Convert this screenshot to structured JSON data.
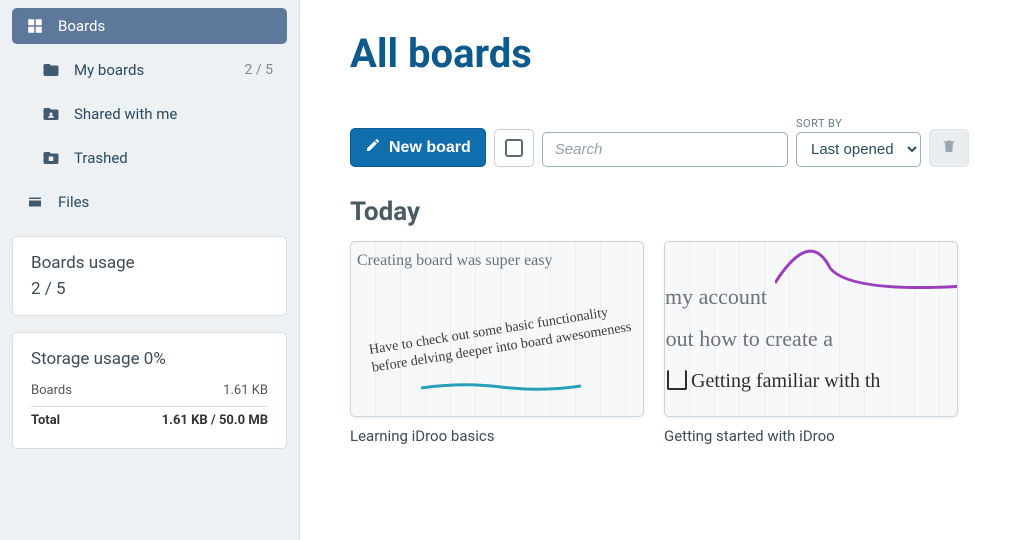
{
  "sidebar": {
    "items": [
      {
        "label": "Boards",
        "count": ""
      },
      {
        "label": "My boards",
        "count": "2 / 5"
      },
      {
        "label": "Shared with me",
        "count": ""
      },
      {
        "label": "Trashed",
        "count": ""
      },
      {
        "label": "Files",
        "count": ""
      }
    ]
  },
  "usage": {
    "boards_title": "Boards usage",
    "boards_value": "2 / 5",
    "storage_title": "Storage usage 0%",
    "rows": {
      "boards_label": "Boards",
      "boards_size": "1.61 KB",
      "total_label": "Total",
      "total_size": "1.61 KB / 50.0 MB"
    }
  },
  "main": {
    "title": "All boards",
    "new_board_label": "New board",
    "search_placeholder": "Search",
    "sort_label": "SORT BY",
    "sort_selected": "Last opened",
    "section_today": "Today",
    "boards": [
      {
        "caption": "Learning iDroo basics",
        "thumb_text1": "Creating board was super easy",
        "thumb_text2": "Have to check out some basic functionality before delving deeper into board awesomeness"
      },
      {
        "caption": "Getting started with iDroo",
        "thumb_text1": "my account",
        "thumb_text2": "ured out how to create a",
        "thumb_text3": "Getting familiar with th"
      }
    ]
  }
}
